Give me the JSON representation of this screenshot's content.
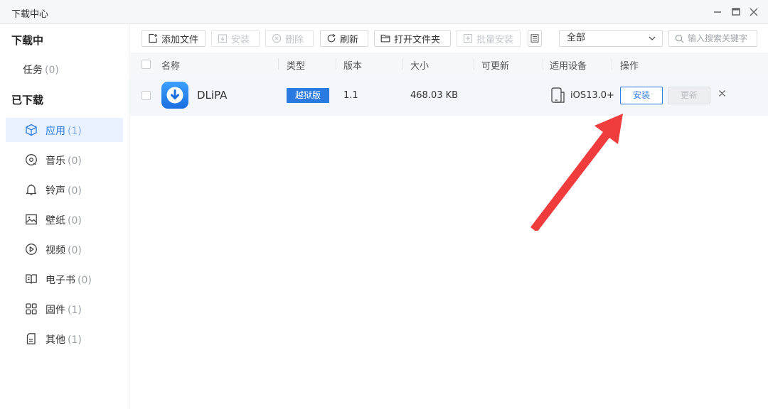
{
  "window": {
    "title": "下载中心"
  },
  "sidebar": {
    "downloading_title": "下载中心",
    "downloading_header": "下载中",
    "task": {
      "label": "任务",
      "count": "(0)"
    },
    "downloaded_header": "已下载",
    "items": [
      {
        "label": "应用",
        "count": "(1)",
        "icon": "cube-icon"
      },
      {
        "label": "音乐",
        "count": "(0)",
        "icon": "disc-icon"
      },
      {
        "label": "铃声",
        "count": "(0)",
        "icon": "bell-icon"
      },
      {
        "label": "壁纸",
        "count": "(0)",
        "icon": "image-icon"
      },
      {
        "label": "视频",
        "count": "(0)",
        "icon": "play-circle-icon"
      },
      {
        "label": "电子书",
        "count": "(0)",
        "icon": "book-icon"
      },
      {
        "label": "固件",
        "count": "(1)",
        "icon": "grid-icon"
      },
      {
        "label": "其他",
        "count": "(1)",
        "icon": "document-icon"
      }
    ]
  },
  "toolbar": {
    "add_file": "添加文件",
    "install": "安装",
    "delete": "删除",
    "refresh": "刷新",
    "open_folder": "打开文件夹",
    "batch_install": "批量安装",
    "filter_value": "全部",
    "search_placeholder": "输入搜索关键字"
  },
  "table": {
    "headers": [
      "名称",
      "类型",
      "版本",
      "大小",
      "可更新",
      "适用设备",
      "操作"
    ],
    "rows": [
      {
        "name": "DLiPA",
        "type": "越狱版",
        "version": "1.1",
        "size": "468.03 KB",
        "updatable": "",
        "device": "iOS13.0+",
        "install_label": "安装",
        "update_label": "更新"
      }
    ]
  },
  "colors": {
    "accent": "#2a7ae2",
    "annotation_arrow": "#f03c3c"
  }
}
